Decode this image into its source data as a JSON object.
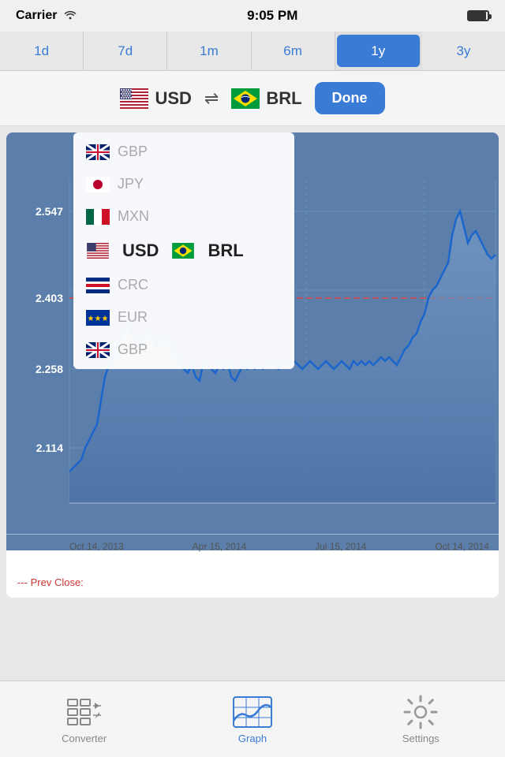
{
  "statusBar": {
    "carrier": "Carrier",
    "wifi": "📶",
    "time": "9:05 PM"
  },
  "periodTabs": {
    "tabs": [
      "1d",
      "7d",
      "1m",
      "6m",
      "1y",
      "3y"
    ],
    "activeIndex": 4
  },
  "currencyBar": {
    "from": "USD",
    "to": "BRL",
    "doneLabel": "Done",
    "swapSymbol": "⇌"
  },
  "chart": {
    "yLabels": [
      "2.547",
      "2.403",
      "2.258",
      "2.114"
    ],
    "xLabels": [
      "Oct 14, 2013",
      "Apr 15, 2014",
      "Jul 15, 2014",
      "Oct 14, 2014"
    ],
    "prevCloseLabel": "--- Prev Close:"
  },
  "dropdown": {
    "items": [
      {
        "code": "GBP",
        "flagType": "gb"
      },
      {
        "code": "JPY",
        "flagType": "jp"
      },
      {
        "code": "MXN",
        "flagType": "mx"
      },
      {
        "code": "USD",
        "flagType": "us"
      },
      {
        "code": "BRL",
        "flagType": "br"
      },
      {
        "code": "CRC",
        "flagType": "cr"
      },
      {
        "code": "EUR",
        "flagType": "eu"
      },
      {
        "code": "GBP",
        "flagType": "gb2"
      }
    ]
  },
  "tabBar": {
    "tabs": [
      {
        "label": "Converter",
        "icon": "converter",
        "active": false
      },
      {
        "label": "Graph",
        "icon": "graph",
        "active": true
      },
      {
        "label": "Settings",
        "icon": "settings",
        "active": false
      }
    ]
  }
}
